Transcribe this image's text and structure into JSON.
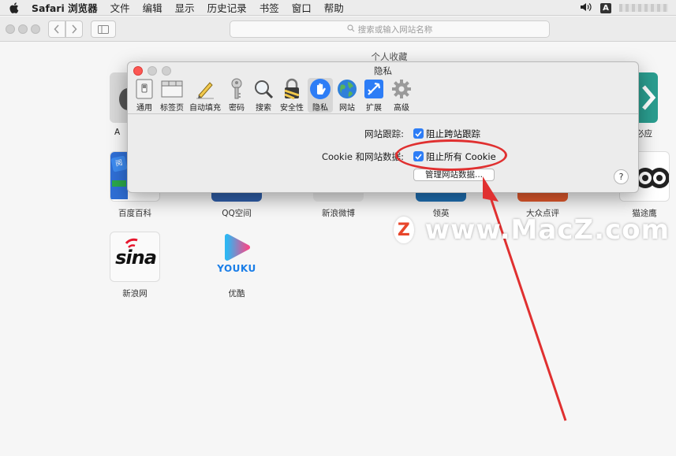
{
  "menubar": {
    "app_name": "Safari 浏览器",
    "items": [
      "文件",
      "编辑",
      "显示",
      "历史记录",
      "书签",
      "窗口",
      "帮助"
    ],
    "ime_label": "A"
  },
  "toolbar": {
    "address_placeholder": "搜索或输入网站名称"
  },
  "favorites": {
    "title": "个人收藏",
    "items": [
      {
        "label": "百度百科"
      },
      {
        "label": "QQ空间"
      },
      {
        "label": "新浪微博"
      },
      {
        "label": "领英"
      },
      {
        "label": "大众点评"
      },
      {
        "label": "猫途鹰"
      },
      {
        "label": "新浪网",
        "logo_text": "sina"
      },
      {
        "label": "优酷",
        "logo_text": "YOUKU"
      },
      {
        "label": "必应"
      }
    ],
    "partial_label_left": "A"
  },
  "dialog": {
    "title": "隐私",
    "tabs": [
      {
        "label": "通用",
        "icon": "switch-icon"
      },
      {
        "label": "标签页",
        "icon": "tabs-icon"
      },
      {
        "label": "自动填充",
        "icon": "pencil-icon"
      },
      {
        "label": "密码",
        "icon": "key-icon"
      },
      {
        "label": "搜索",
        "icon": "magnifier-icon"
      },
      {
        "label": "安全性",
        "icon": "lock-icon"
      },
      {
        "label": "隐私",
        "icon": "hand-icon"
      },
      {
        "label": "网站",
        "icon": "globe-icon"
      },
      {
        "label": "扩展",
        "icon": "puzzle-icon"
      },
      {
        "label": "高级",
        "icon": "gear-icon"
      }
    ],
    "active_tab": "隐私",
    "tracking_label": "网站跟踪:",
    "tracking_option": "阻止跨站跟踪",
    "cookie_label": "Cookie 和网站数据:",
    "cookie_option": "阻止所有 Cookie",
    "manage_button": "管理网站数据...",
    "help_label": "?"
  },
  "watermark": {
    "logo_letter": "Z",
    "text": "www.MacZ.com"
  },
  "colors": {
    "accent": "#2d7df6",
    "annotation": "#e03030"
  }
}
